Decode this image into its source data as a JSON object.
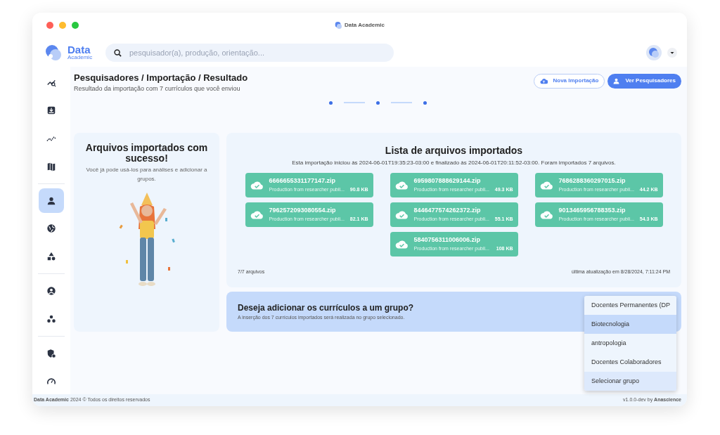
{
  "window": {
    "title": "Data Academic"
  },
  "header": {
    "logo_title": "Data",
    "logo_subtitle": "Academic",
    "search": {
      "placeholder": "pesquisador(a), produção, orientação..."
    }
  },
  "sidebar": {
    "groups": [
      [
        {
          "selected": false
        },
        {
          "selected": false
        },
        {
          "selected": false
        },
        {
          "selected": false
        }
      ],
      [
        {
          "selected": true
        },
        {
          "selected": false
        },
        {
          "selected": false
        }
      ],
      [
        {
          "selected": false
        },
        {
          "selected": false
        }
      ],
      [
        {
          "selected": false
        },
        {
          "selected": false
        }
      ]
    ]
  },
  "page": {
    "title": "Pesquisadores / Importação / Resultado",
    "subtitle": "Resultado da importação com 7 currículos que você enviou",
    "buttons": [
      {
        "label": "Nova Importação",
        "kind": "outline"
      },
      {
        "label": "Ver Pesquisadores",
        "kind": "primary"
      }
    ]
  },
  "success_card": {
    "title": "Arquivos importados com sucesso!",
    "text": "Você já pode usá-los para análises e adicionar a grupos."
  },
  "files_card": {
    "title": "Lista de arquivos importados",
    "summary": "Esta importação iniciou às 2024-06-01T19:35:23-03:00 e finalizado às 2024-06-01T20:11:52-03:00. Foram importados 7 arquivos.",
    "files": [
      {
        "name": "6666655331177147.zip",
        "description": "Production from researcher publi...",
        "size": "90.8 KB"
      },
      {
        "name": "6959807888629144.zip",
        "description": "Production from researcher publi...",
        "size": "49.3 KB"
      },
      {
        "name": "7686288360297015.zip",
        "description": "Production from researcher publi...",
        "size": "44.2 KB"
      },
      {
        "name": "7962572093080554.zip",
        "description": "Production from researcher publi...",
        "size": "82.1 KB"
      },
      {
        "name": "8446477574262372.zip",
        "description": "Production from researcher publi...",
        "size": "55.1 KB"
      },
      {
        "name": "9013465956788353.zip",
        "description": "Production from researcher publi...",
        "size": "54.3 KB"
      },
      {
        "name": "5840756311006006.zip",
        "description": "Production from researcher publi...",
        "size": "108 KB"
      }
    ],
    "count": "7/7 arquivos",
    "updated": "última atualização em 8/28/2024, 7:11:24 PM"
  },
  "group_banner": {
    "title": "Deseja adicionar os currículos a um grupo?",
    "text": "A inserção dos 7 currículos importados será realizada no grupo selecionado.",
    "dropdown": [
      {
        "label": "Docentes Permanentes (DP",
        "selected": false,
        "highlighted": false
      },
      {
        "label": "Biotecnologia",
        "selected": false,
        "highlighted": true
      },
      {
        "label": "antropologia",
        "selected": false,
        "highlighted": false
      },
      {
        "label": "Docentes Colaboradores",
        "selected": false,
        "highlighted": false
      },
      {
        "label": "Selecionar grupo",
        "selected": true,
        "highlighted": false
      }
    ]
  },
  "footer": {
    "left": "**Data Academic** 2024 © Todos os direitos reservados",
    "right": "v1.0.0-dev by **Anascience**"
  }
}
